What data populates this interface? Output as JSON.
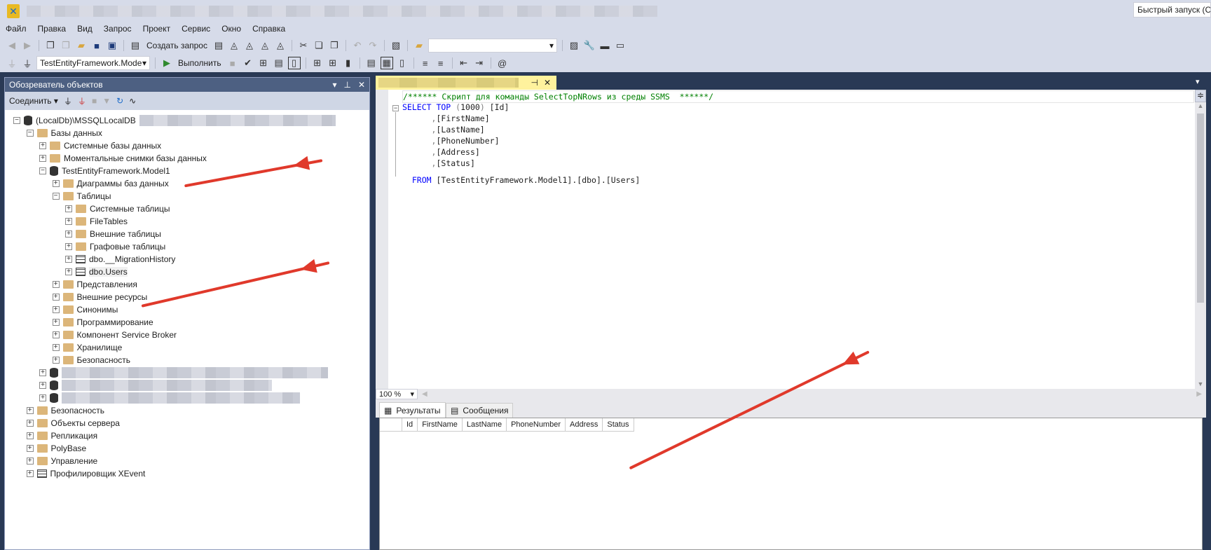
{
  "quick_launch": "Быстрый запуск (Ct",
  "menu": [
    "Файл",
    "Правка",
    "Вид",
    "Запрос",
    "Проект",
    "Сервис",
    "Окно",
    "Справка"
  ],
  "toolbar": {
    "new_query": "Создать запрос",
    "database": "TestEntityFramework.Mode",
    "execute": "Выполнить"
  },
  "object_explorer": {
    "title": "Обозреватель объектов",
    "connect": "Соединить",
    "tree": [
      {
        "label": "(LocalDb)\\MSSQLLocalDB",
        "level": 0,
        "icon": "server",
        "expanded": true
      },
      {
        "label": "Базы данных",
        "level": 1,
        "icon": "folder",
        "expanded": true
      },
      {
        "label": "Системные базы данных",
        "level": 2,
        "icon": "folder"
      },
      {
        "label": "Моментальные снимки базы данных",
        "level": 2,
        "icon": "folder"
      },
      {
        "label": "TestEntityFramework.Model1",
        "level": 2,
        "icon": "database",
        "expanded": true
      },
      {
        "label": "Диаграммы баз данных",
        "level": 3,
        "icon": "folder"
      },
      {
        "label": "Таблицы",
        "level": 3,
        "icon": "folder",
        "expanded": true
      },
      {
        "label": "Системные таблицы",
        "level": 4,
        "icon": "folder"
      },
      {
        "label": "FileTables",
        "level": 4,
        "icon": "folder"
      },
      {
        "label": "Внешние таблицы",
        "level": 4,
        "icon": "folder"
      },
      {
        "label": "Графовые таблицы",
        "level": 4,
        "icon": "folder"
      },
      {
        "label": "dbo.__MigrationHistory",
        "level": 4,
        "icon": "table"
      },
      {
        "label": "dbo.Users",
        "level": 4,
        "icon": "table",
        "selected": true
      },
      {
        "label": "Представления",
        "level": 3,
        "icon": "folder"
      },
      {
        "label": "Внешние ресурсы",
        "level": 3,
        "icon": "folder"
      },
      {
        "label": "Синонимы",
        "level": 3,
        "icon": "folder"
      },
      {
        "label": "Программирование",
        "level": 3,
        "icon": "folder"
      },
      {
        "label": "Компонент Service Broker",
        "level": 3,
        "icon": "folder"
      },
      {
        "label": "Хранилище",
        "level": 3,
        "icon": "folder"
      },
      {
        "label": "Безопасность",
        "level": 3,
        "icon": "folder"
      },
      {
        "label": "",
        "level": 2,
        "icon": "database",
        "blurred": true
      },
      {
        "label": "",
        "level": 2,
        "icon": "database",
        "blurred": true
      },
      {
        "label": "",
        "level": 2,
        "icon": "database",
        "blurred": true
      },
      {
        "label": "Безопасность",
        "level": 1,
        "icon": "folder"
      },
      {
        "label": "Объекты сервера",
        "level": 1,
        "icon": "folder"
      },
      {
        "label": "Репликация",
        "level": 1,
        "icon": "folder"
      },
      {
        "label": "PolyBase",
        "level": 1,
        "icon": "folder"
      },
      {
        "label": "Управление",
        "level": 1,
        "icon": "folder"
      },
      {
        "label": "Профилировщик XEvent",
        "level": 1,
        "icon": "xevent"
      }
    ]
  },
  "editor": {
    "comment": "/****** Скрипт для команды SelectTopNRows из среды SSMS  ******/",
    "lines": [
      {
        "kw": "SELECT TOP ",
        "gr": "(",
        "txt": "1000",
        "gr2": ") ",
        "rest": "[Id]"
      },
      {
        "indent": "      ",
        "gr": ",",
        "rest": "[FirstName]"
      },
      {
        "indent": "      ",
        "gr": ",",
        "rest": "[LastName]"
      },
      {
        "indent": "      ",
        "gr": ",",
        "rest": "[PhoneNumber]"
      },
      {
        "indent": "      ",
        "gr": ",",
        "rest": "[Address]"
      },
      {
        "indent": "      ",
        "gr": ",",
        "rest": "[Status]"
      }
    ],
    "from_kw": "FROM ",
    "from_rest": "[TestEntityFramework.Model1].[dbo].[Users]",
    "zoom": "100 %"
  },
  "results": {
    "tabs": [
      "Результаты",
      "Сообщения"
    ],
    "columns": [
      "Id",
      "FirstName",
      "LastName",
      "PhoneNumber",
      "Address",
      "Status"
    ]
  },
  "colors": {
    "accent": "#293955",
    "arrow": "#e0392b",
    "tab": "#fff29d"
  }
}
